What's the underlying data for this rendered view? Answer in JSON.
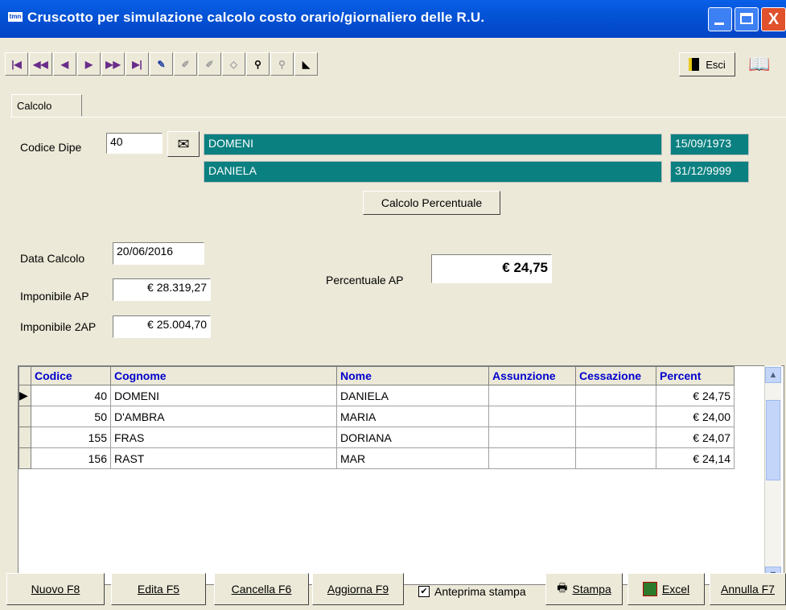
{
  "window": {
    "title": "Cruscotto per simulazione calcolo costo orario/giornaliero delle R.U.",
    "app_icon": "tmn",
    "close_glyph": "X"
  },
  "toolbar": {
    "exit_label": "Esci",
    "icons": [
      "first-record-icon",
      "prev-page-icon",
      "prev-record-icon",
      "next-record-icon",
      "next-page-icon",
      "last-record-icon",
      "new-record-icon",
      "edit-record-icon",
      "edit-disabled-icon",
      "erase-icon",
      "search-icon",
      "search-disabled-icon",
      "filter-icon",
      "help-book-icon"
    ]
  },
  "tabs": [
    {
      "label": "Calcolo"
    }
  ],
  "form": {
    "codice_dipe_label": "Codice Dipe",
    "codice_dipe_value": "40",
    "surname": "DOMENI",
    "birth_date": "15/09/1973",
    "name": "DANIELA",
    "end_date": "31/12/9999",
    "calc_button": "Calcolo Percentuale",
    "data_calcolo_label": "Data Calcolo",
    "data_calcolo_value": "20/06/2016",
    "imponibile_ap_label": "Imponibile AP",
    "imponibile_ap_value": "€ 28.319,27",
    "imponibile_2ap_label": "Imponibile 2AP",
    "imponibile_2ap_value": "€ 25.004,70",
    "percentuale_ap_label": "Percentuale AP",
    "percentuale_ap_value": "€ 24,75"
  },
  "grid": {
    "columns": [
      "Codice",
      "Cognome",
      "Nome",
      "Assunzione",
      "Cessazione",
      "Percent"
    ],
    "rows": [
      {
        "codice": "40",
        "cognome": "DOMENI",
        "nome": "DANIELA",
        "assunzione": "",
        "cessazione": "",
        "percent": "€ 24,75"
      },
      {
        "codice": "50",
        "cognome": "D'AMBRA",
        "nome": "MARIA",
        "assunzione": "",
        "cessazione": "",
        "percent": "€ 24,00"
      },
      {
        "codice": "155",
        "cognome": "FRAS",
        "nome": "DORIANA",
        "assunzione": "",
        "cessazione": "",
        "percent": "€ 24,07"
      },
      {
        "codice": "156",
        "cognome": "RAST",
        "nome": "MAR",
        "assunzione": "",
        "cessazione": "",
        "percent": "€ 24,14"
      }
    ]
  },
  "footer": {
    "nuovo": "Nuovo F8",
    "edita": "Edita F5",
    "cancella": "Cancella F6",
    "aggiorna": "Aggiorna F9",
    "anteprima": "Anteprima stampa",
    "anteprima_checked": true,
    "stampa": "Stampa",
    "excel": "Excel",
    "annulla": "Annulla F7"
  }
}
